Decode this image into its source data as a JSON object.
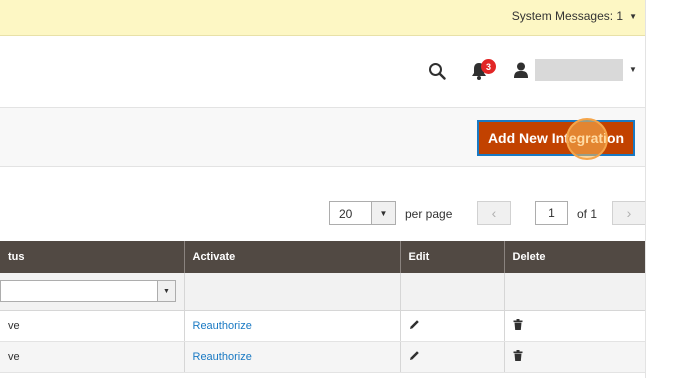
{
  "system_messages": {
    "label": "System Messages: 1"
  },
  "header": {
    "notification_count": "3"
  },
  "actions": {
    "add_button_label": "Add New Integration"
  },
  "pager": {
    "per_page_value": "20",
    "per_page_label": "per page",
    "current_page": "1",
    "total_pages_label": "of 1"
  },
  "grid": {
    "columns": [
      "tus",
      "Activate",
      "Edit",
      "Delete"
    ],
    "rows": [
      {
        "status": "ve",
        "activate": "Reauthorize"
      },
      {
        "status": "ve",
        "activate": "Reauthorize"
      }
    ]
  },
  "icons": {
    "search": "search-icon",
    "bell": "bell-icon",
    "user": "user-icon",
    "edit": "pencil-icon",
    "delete": "trash-icon"
  },
  "colors": {
    "primary_button": "#c24200",
    "grid_header": "#514943",
    "link": "#1979c3",
    "system_bar": "#fdf7c4",
    "badge": "#e22626"
  }
}
